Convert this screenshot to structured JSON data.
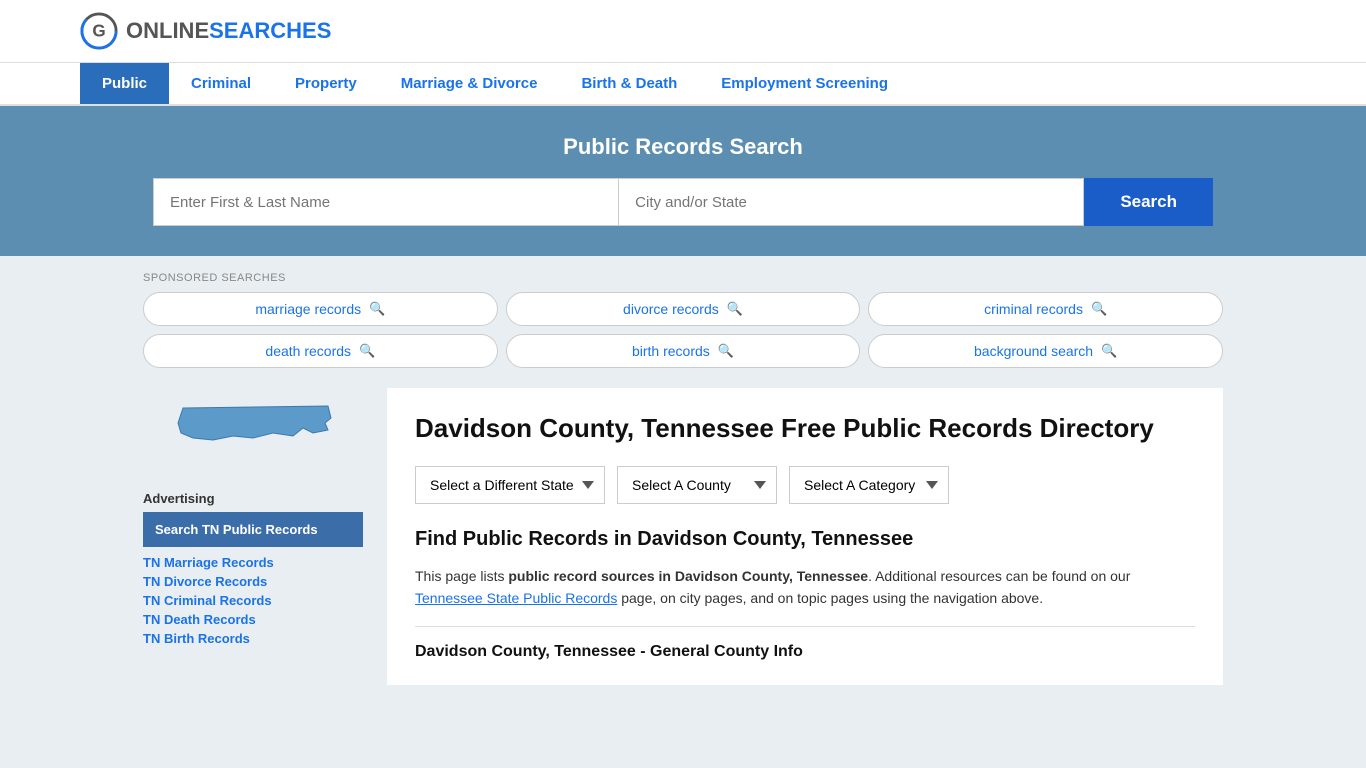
{
  "logo": {
    "online": "ONLINE",
    "searches": "SEARCHES"
  },
  "nav": {
    "items": [
      {
        "label": "Public",
        "active": true
      },
      {
        "label": "Criminal",
        "active": false
      },
      {
        "label": "Property",
        "active": false
      },
      {
        "label": "Marriage & Divorce",
        "active": false
      },
      {
        "label": "Birth & Death",
        "active": false
      },
      {
        "label": "Employment Screening",
        "active": false
      }
    ]
  },
  "search_banner": {
    "title": "Public Records Search",
    "name_placeholder": "Enter First & Last Name",
    "location_placeholder": "City and/or State",
    "button_label": "Search"
  },
  "sponsored": {
    "label": "SPONSORED SEARCHES",
    "items": [
      {
        "label": "marriage records"
      },
      {
        "label": "divorce records"
      },
      {
        "label": "criminal records"
      },
      {
        "label": "death records"
      },
      {
        "label": "birth records"
      },
      {
        "label": "background search"
      }
    ]
  },
  "sidebar": {
    "advertising_label": "Advertising",
    "ad_button": "Search TN Public Records",
    "links": [
      {
        "label": "TN Marriage Records"
      },
      {
        "label": "TN Divorce Records"
      },
      {
        "label": "TN Criminal Records"
      },
      {
        "label": "TN Death Records"
      },
      {
        "label": "TN Birth Records"
      }
    ]
  },
  "main": {
    "page_title": "Davidson County, Tennessee Free Public Records Directory",
    "dropdowns": {
      "state": "Select a Different State",
      "county": "Select A County",
      "category": "Select A Category"
    },
    "find_title": "Find Public Records in Davidson County, Tennessee",
    "description_part1": "This page lists ",
    "description_bold": "public record sources in Davidson County, Tennessee",
    "description_part2": ". Additional resources can be found on our ",
    "description_link": "Tennessee State Public Records",
    "description_part3": " page, on city pages, and on topic pages using the navigation above.",
    "general_info_title": "Davidson County, Tennessee - General County Info"
  }
}
